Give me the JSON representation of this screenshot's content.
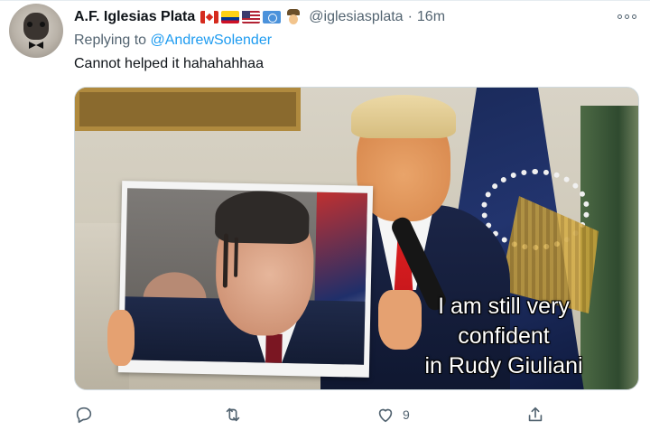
{
  "author": {
    "display_name": "A.F. Iglesias Plata",
    "handle": "@iglesiasplata",
    "separator": "·",
    "time": "16m",
    "badges": [
      "canada-flag",
      "colombia-flag",
      "usa-flag",
      "united-nations-flag",
      "detective-emoji"
    ]
  },
  "reply": {
    "prefix": "Replying to",
    "to_handle": "@AndrewSolender"
  },
  "tweet": {
    "text": "Cannot helped it hahahahhaa"
  },
  "media": {
    "caption_lines": [
      "I am still very",
      "confident",
      "in Rudy Giuliani"
    ]
  },
  "actions": {
    "reply": {
      "icon": "reply-icon",
      "count": ""
    },
    "retweet": {
      "icon": "retweet-icon",
      "count": ""
    },
    "like": {
      "icon": "heart-icon",
      "count": "9"
    },
    "share": {
      "icon": "share-icon",
      "count": ""
    }
  },
  "colors": {
    "link": "#1d9bf0",
    "secondary_text": "#536471",
    "primary_text": "#0f1419"
  }
}
